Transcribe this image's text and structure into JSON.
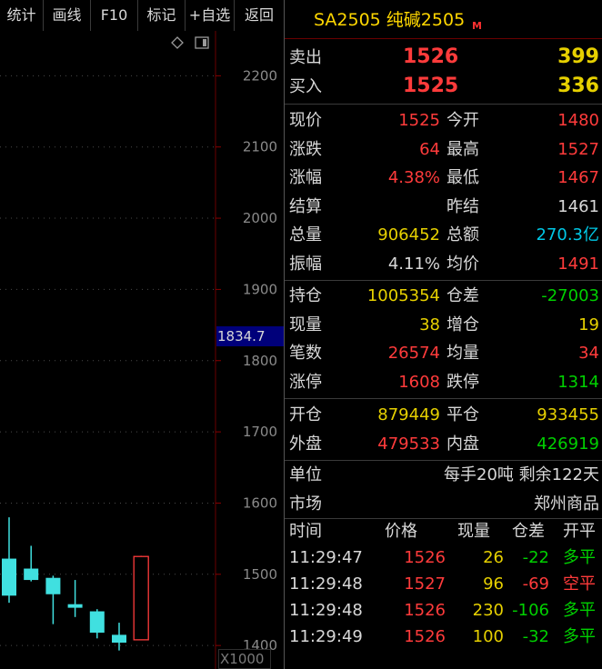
{
  "toolbar": {
    "buttons": [
      "统计",
      "画线",
      "F10",
      "标记",
      "+自选",
      "返回"
    ]
  },
  "chart": {
    "y_ticks": [
      "2200",
      "2100",
      "2000",
      "1900",
      "1800",
      "1700",
      "1600",
      "1500",
      "1400"
    ],
    "cursor_price": "1834.7",
    "unit": "X1000"
  },
  "chart_data": {
    "type": "candlestick",
    "y_range": [
      1367,
      2263
    ],
    "candles": [
      {
        "open": 1522,
        "close": 1470,
        "high": 1580,
        "low": 1460,
        "color": "#40e0e0",
        "filled": true
      },
      {
        "open": 1508,
        "close": 1492,
        "high": 1540,
        "low": 1490,
        "color": "#40e0e0",
        "filled": true
      },
      {
        "open": 1495,
        "close": 1472,
        "high": 1498,
        "low": 1430,
        "color": "#40e0e0",
        "filled": true
      },
      {
        "open": 1458,
        "close": 1453,
        "high": 1492,
        "low": 1440,
        "color": "#40e0e0",
        "filled": true
      },
      {
        "open": 1448,
        "close": 1418,
        "high": 1451,
        "low": 1410,
        "color": "#40e0e0",
        "filled": true
      },
      {
        "open": 1415,
        "close": 1404,
        "high": 1432,
        "low": 1393,
        "color": "#40e0e0",
        "filled": true
      },
      {
        "open": 1408,
        "close": 1525,
        "high": 1526,
        "low": 1408,
        "color": "#ff3b3b",
        "filled": false
      }
    ]
  },
  "panel": {
    "title": "SA2505 纯碱2505",
    "title_flag": "M",
    "sell": {
      "label": "卖出",
      "price": "1526",
      "vol": "399"
    },
    "buy": {
      "label": "买入",
      "price": "1525",
      "vol": "336"
    },
    "stats": [
      {
        "l1": "现价",
        "v1": "1525",
        "c1": "red",
        "l2": "今开",
        "v2": "1480",
        "c2": "red"
      },
      {
        "l1": "涨跌",
        "v1": "64",
        "c1": "red",
        "l2": "最高",
        "v2": "1527",
        "c2": "red"
      },
      {
        "l1": "涨幅",
        "v1": "4.38%",
        "c1": "red",
        "l2": "最低",
        "v2": "1467",
        "c2": "red"
      },
      {
        "l1": "结算",
        "v1": "",
        "c1": "wht",
        "l2": "昨结",
        "v2": "1461",
        "c2": "wht"
      },
      {
        "l1": "总量",
        "v1": "906452",
        "c1": "yel",
        "l2": "总额",
        "v2": "270.3亿",
        "c2": "cyn"
      },
      {
        "l1": "振幅",
        "v1": "4.11%",
        "c1": "wht",
        "l2": "均价",
        "v2": "1491",
        "c2": "red"
      }
    ],
    "oi": [
      {
        "l1": "持仓",
        "v1": "1005354",
        "c1": "yel",
        "l2": "仓差",
        "v2": "-27003",
        "c2": "grn"
      },
      {
        "l1": "现量",
        "v1": "38",
        "c1": "yel",
        "l2": "增仓",
        "v2": "19",
        "c2": "yel"
      },
      {
        "l1": "笔数",
        "v1": "26574",
        "c1": "red",
        "l2": "均量",
        "v2": "34",
        "c2": "red"
      },
      {
        "l1": "涨停",
        "v1": "1608",
        "c1": "red",
        "l2": "跌停",
        "v2": "1314",
        "c2": "grn"
      }
    ],
    "open_close": [
      {
        "l1": "开仓",
        "v1": "879449",
        "c1": "yel",
        "l2": "平仓",
        "v2": "933455",
        "c2": "yel"
      },
      {
        "l1": "外盘",
        "v1": "479533",
        "c1": "red",
        "l2": "内盘",
        "v2": "426919",
        "c2": "grn"
      }
    ],
    "unit": {
      "label": "单位",
      "value": "每手20吨  剩余122天"
    },
    "market": {
      "label": "市场",
      "value": "郑州商品"
    },
    "trades_header": [
      "时间",
      "价格",
      "现量",
      "仓差",
      "开平"
    ],
    "trades": [
      {
        "time": "11:29:47",
        "price": "1526",
        "vol": "26",
        "diff": "-22",
        "type": "多平",
        "type_color": "grn",
        "diff_color": "grn"
      },
      {
        "time": "11:29:48",
        "price": "1527",
        "vol": "96",
        "diff": "-69",
        "type": "空平",
        "type_color": "red",
        "diff_color": "red"
      },
      {
        "time": "11:29:48",
        "price": "1526",
        "vol": "230",
        "diff": "-106",
        "type": "多平",
        "type_color": "grn",
        "diff_color": "grn"
      },
      {
        "time": "11:29:49",
        "price": "1526",
        "vol": "100",
        "diff": "-32",
        "type": "多平",
        "type_color": "grn",
        "diff_color": "grn"
      }
    ]
  }
}
